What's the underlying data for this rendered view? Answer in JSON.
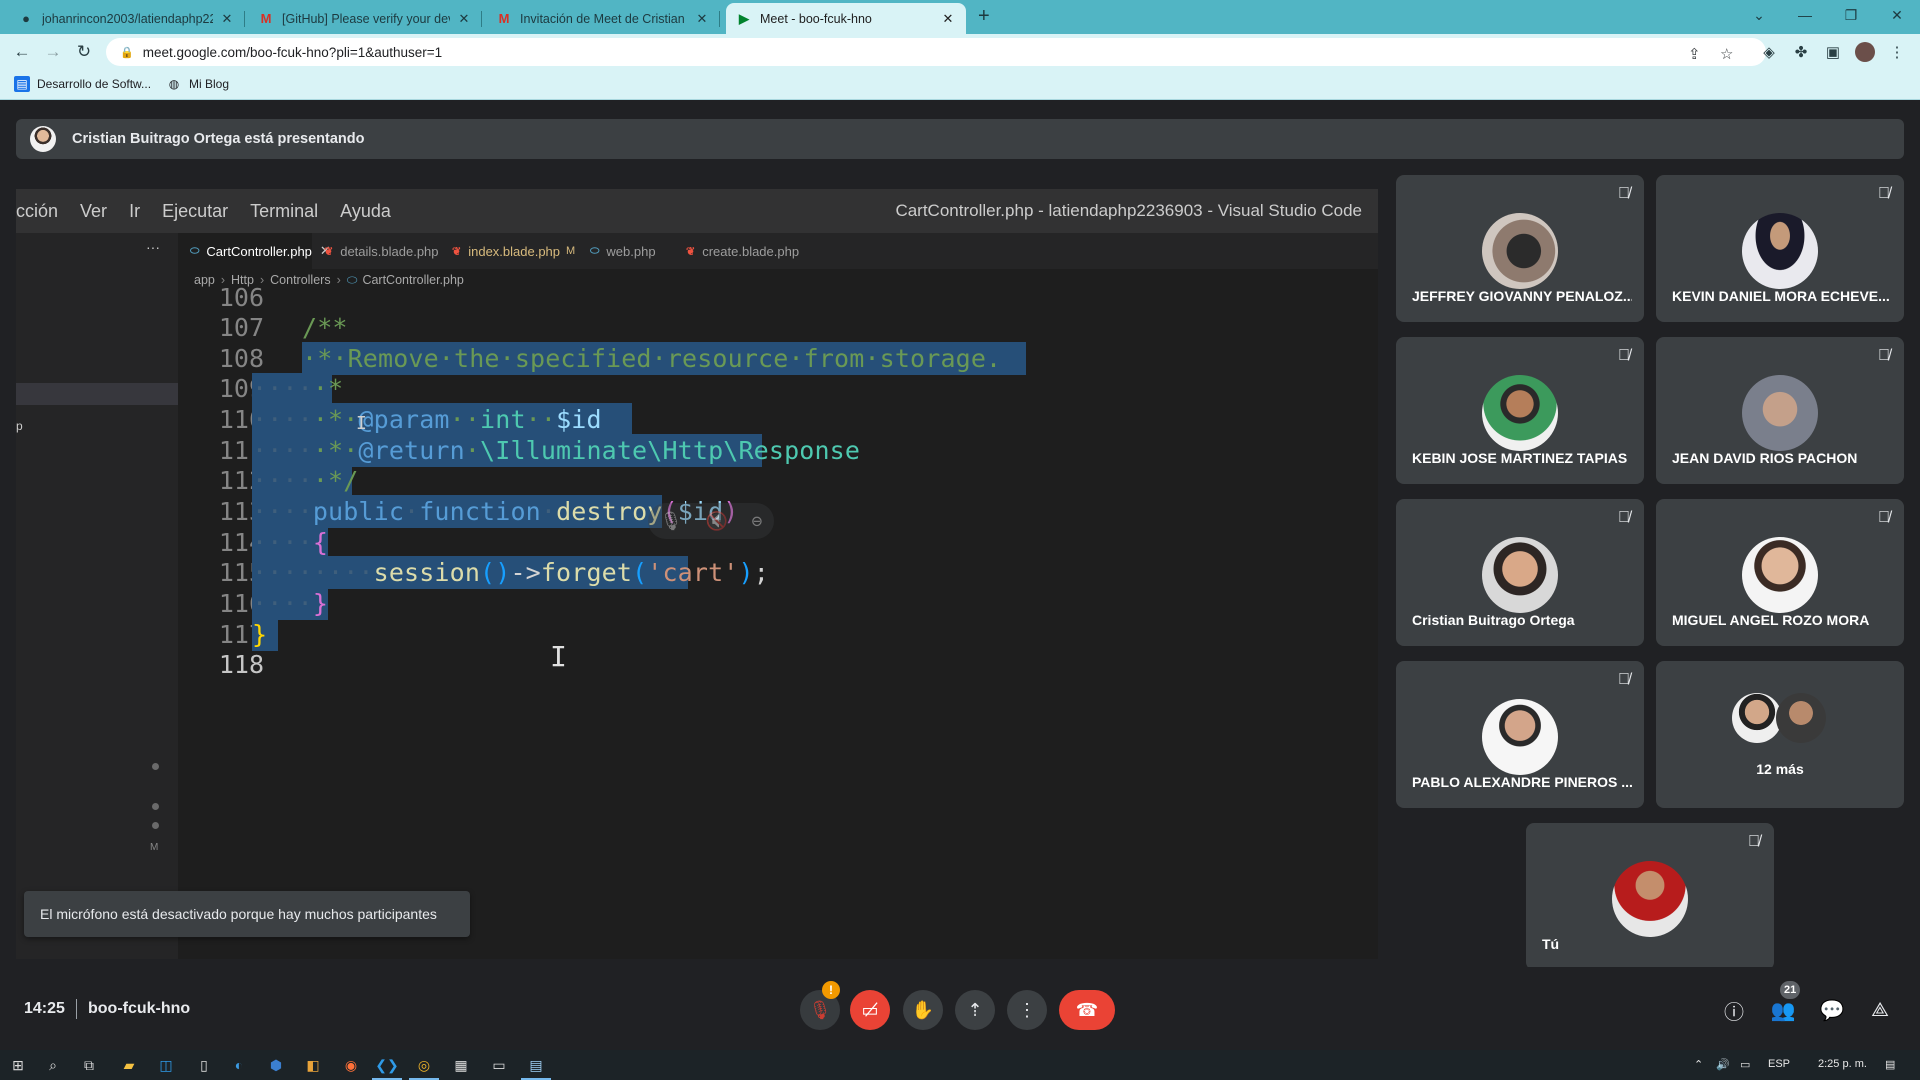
{
  "browser": {
    "tabs": [
      {
        "title": "johanrincon2003/latiendaphp2236903",
        "icon": "github-icon"
      },
      {
        "title": "[GitHub] Please verify your device",
        "icon": "gmail-icon"
      },
      {
        "title": "Invitación de Meet de Cristian Buitrago",
        "icon": "gmail-icon"
      },
      {
        "title": "Meet - boo-fcuk-hno",
        "icon": "meet-icon"
      }
    ],
    "url": "meet.google.com/boo-fcuk-hno?pli=1&authuser=1",
    "bookmarks": [
      {
        "label": "Desarrollo de Softw...",
        "icon": "bookmark-app-icon"
      },
      {
        "label": "Mi Blog",
        "icon": "globe-icon"
      }
    ]
  },
  "meet": {
    "presenter_banner": "Cristian Buitrago Ortega está presentando",
    "toast": "El micrófono está desactivado porque hay muchos participantes",
    "time": "14:25",
    "meeting_code": "boo-fcuk-hno",
    "participant_count": "21",
    "warning_mark": "!",
    "participants": [
      {
        "name": "JEFFREY GIOVANNY PENALOZ...",
        "muted": true
      },
      {
        "name": "KEVIN DANIEL MORA ECHEVE...",
        "muted": true
      },
      {
        "name": "KEBIN JOSE MARTINEZ TAPIAS",
        "muted": true
      },
      {
        "name": "JEAN DAVID RIOS PACHON",
        "muted": true
      },
      {
        "name": "Cristian Buitrago Ortega",
        "muted": true
      },
      {
        "name": "MIGUEL ANGEL ROZO MORA",
        "muted": true
      },
      {
        "name": "PABLO ALEXANDRE PINEROS ...",
        "muted": true
      },
      {
        "name": "12 más",
        "muted": false
      },
      {
        "name": "Tú",
        "muted": true
      }
    ]
  },
  "vscode": {
    "menu": [
      "cción",
      "Ver",
      "Ir",
      "Ejecutar",
      "Terminal",
      "Ayuda"
    ],
    "window_title": "CartController.php - latiendaphp2236903 - Visual Studio Code",
    "tabs": [
      {
        "label": "CartController.php",
        "active": true,
        "modified": ""
      },
      {
        "label": "details.blade.php",
        "active": false,
        "modified": ""
      },
      {
        "label": "index.blade.php",
        "active": false,
        "modified": "M"
      },
      {
        "label": "web.php",
        "active": false,
        "modified": ""
      },
      {
        "label": "create.blade.php",
        "active": false,
        "modified": ""
      }
    ],
    "breadcrumb": [
      "app",
      "Http",
      "Controllers",
      "CartController.php"
    ],
    "sidebar_letter": "p",
    "git_marker": "M",
    "line_numbers": [
      "106",
      "107",
      "108",
      "109",
      "110",
      "111",
      "112",
      "113",
      "114",
      "115",
      "116",
      "117",
      "118"
    ]
  },
  "taskbar": {
    "language": "ESP",
    "clock": "2:25 p. m."
  }
}
